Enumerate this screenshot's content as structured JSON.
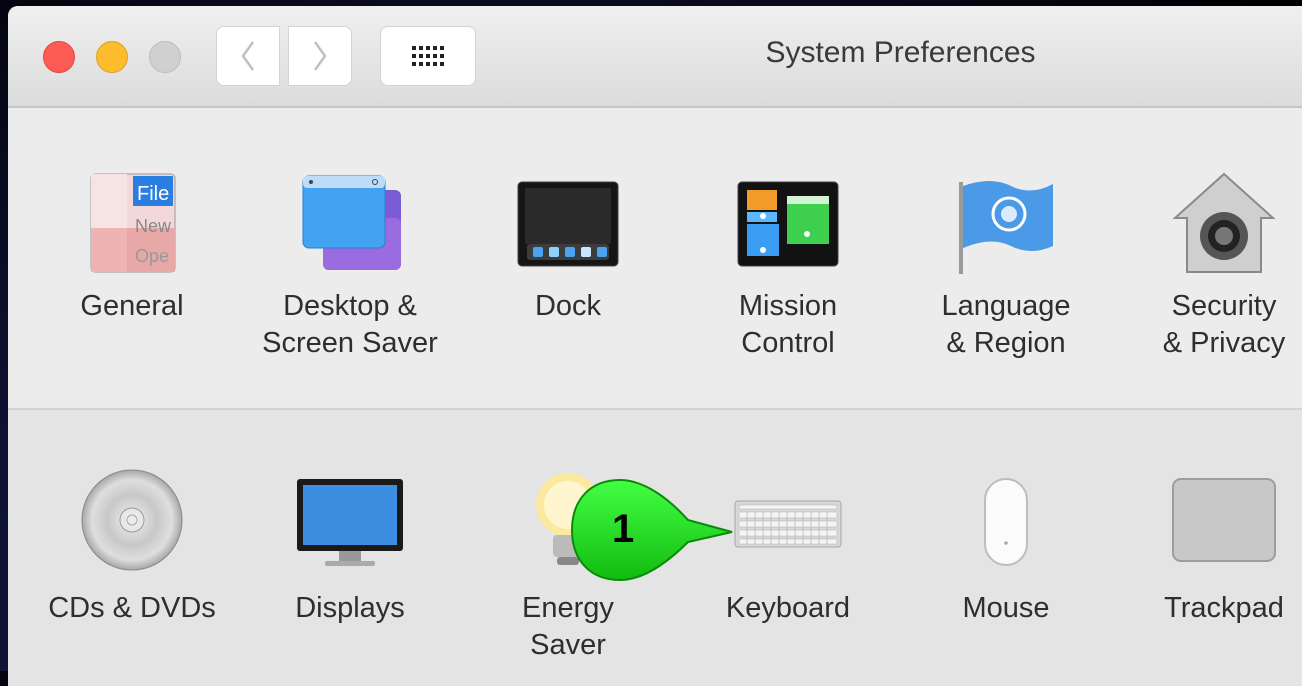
{
  "window": {
    "title": "System Preferences"
  },
  "row1": [
    {
      "name": "general",
      "label": "General",
      "icon": "general-icon"
    },
    {
      "name": "desktop-screen-saver",
      "label": "Desktop &\nScreen Saver",
      "icon": "desktop-icon"
    },
    {
      "name": "dock",
      "label": "Dock",
      "icon": "dock-icon"
    },
    {
      "name": "mission-control",
      "label": "Mission\nControl",
      "icon": "mission-control-icon"
    },
    {
      "name": "language-region",
      "label": "Language\n& Region",
      "icon": "flag-icon"
    },
    {
      "name": "security-privacy",
      "label": "Security\n& Privacy",
      "icon": "security-icon"
    }
  ],
  "row2": [
    {
      "name": "cds-dvds",
      "label": "CDs & DVDs",
      "icon": "disc-icon"
    },
    {
      "name": "displays",
      "label": "Displays",
      "icon": "display-icon"
    },
    {
      "name": "energy-saver",
      "label": "Energy\nSaver",
      "icon": "lightbulb-icon"
    },
    {
      "name": "keyboard",
      "label": "Keyboard",
      "icon": "keyboard-icon"
    },
    {
      "name": "mouse",
      "label": "Mouse",
      "icon": "mouse-icon"
    },
    {
      "name": "trackpad",
      "label": "Trackpad",
      "icon": "trackpad-icon"
    }
  ],
  "general_icon_text": {
    "line1": "File",
    "line2": "New",
    "line3": "Ope"
  },
  "callout": {
    "number": "1",
    "color": "#22dd22"
  },
  "colors": {
    "close": "#fd5c55",
    "minimize": "#fdbb2e",
    "zoom": "#d0d0d0"
  }
}
